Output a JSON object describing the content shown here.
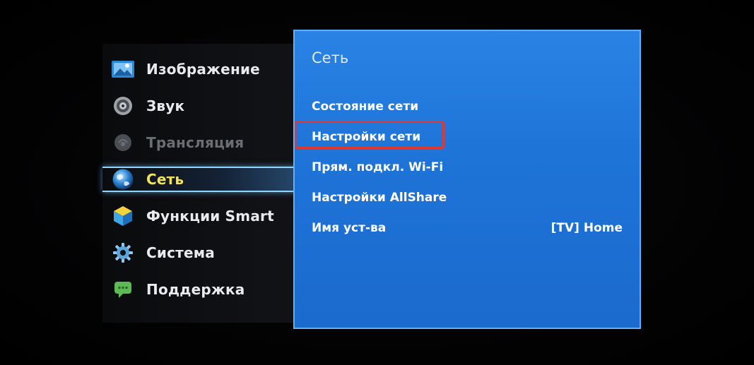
{
  "main_menu": {
    "items": [
      {
        "label": "Изображение",
        "icon": "picture-icon",
        "state": "normal"
      },
      {
        "label": "Звук",
        "icon": "speaker-icon",
        "state": "normal"
      },
      {
        "label": "Трансляция",
        "icon": "broadcast-icon",
        "state": "disabled"
      },
      {
        "label": "Сеть",
        "icon": "globe-icon",
        "state": "active"
      },
      {
        "label": "Функции Smart",
        "icon": "smart-cube-icon",
        "state": "normal"
      },
      {
        "label": "Система",
        "icon": "gear-icon",
        "state": "normal"
      },
      {
        "label": "Поддержка",
        "icon": "support-chat-icon",
        "state": "normal"
      }
    ]
  },
  "submenu": {
    "title": "Сеть",
    "items": [
      {
        "label": "Состояние сети",
        "value": ""
      },
      {
        "label": "Настройки сети",
        "value": "",
        "highlighted": true
      },
      {
        "label": "Прям. подкл. Wi-Fi",
        "value": ""
      },
      {
        "label": "Настройки AllShare",
        "value": ""
      },
      {
        "label": "Имя уст-ва",
        "value": "[TV] Home"
      }
    ]
  },
  "colors": {
    "panel_blue": "#1f74d8",
    "active_text": "#f4e25c",
    "highlight_red": "#e0372f"
  }
}
